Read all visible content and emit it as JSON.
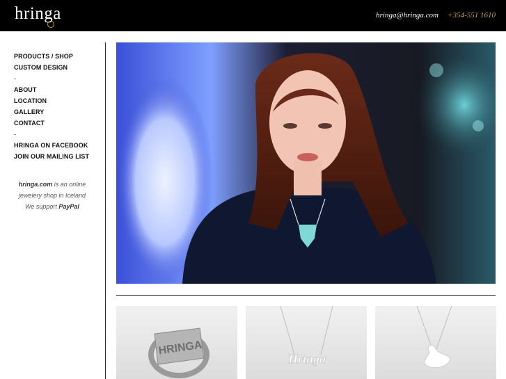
{
  "header": {
    "logo_text": "hringa",
    "email": "hringa@hringa.com",
    "phone": "+354-551 1610"
  },
  "nav": {
    "items": [
      {
        "label": "PRODUCTS / SHOP",
        "type": "link"
      },
      {
        "label": "CUSTOM DESIGN",
        "type": "link"
      },
      {
        "label": "-",
        "type": "separator"
      },
      {
        "label": "ABOUT",
        "type": "link"
      },
      {
        "label": "LOCATION",
        "type": "link"
      },
      {
        "label": "GALLERY",
        "type": "link"
      },
      {
        "label": "CONTACT",
        "type": "link"
      },
      {
        "label": "-",
        "type": "separator"
      },
      {
        "label": "HRINGA ON FACEBOOK",
        "type": "link"
      },
      {
        "label": "JOIN OUR MAILING LIST",
        "type": "link"
      }
    ]
  },
  "blurb": {
    "site": "hringa.com",
    "line1_rest": " is an online",
    "line2": "jewelery shop in Iceland",
    "line3_prefix": "We support ",
    "paypal": "PayPal"
  },
  "products": [
    {
      "name": "ring",
      "engraving": "HRINGA"
    },
    {
      "name": "name-necklace",
      "engraving": "Hringa"
    },
    {
      "name": "duck-necklace"
    }
  ],
  "colors": {
    "topbar": "#000000",
    "accent_gold": "#c9a44a",
    "nav_text": "#111111"
  }
}
